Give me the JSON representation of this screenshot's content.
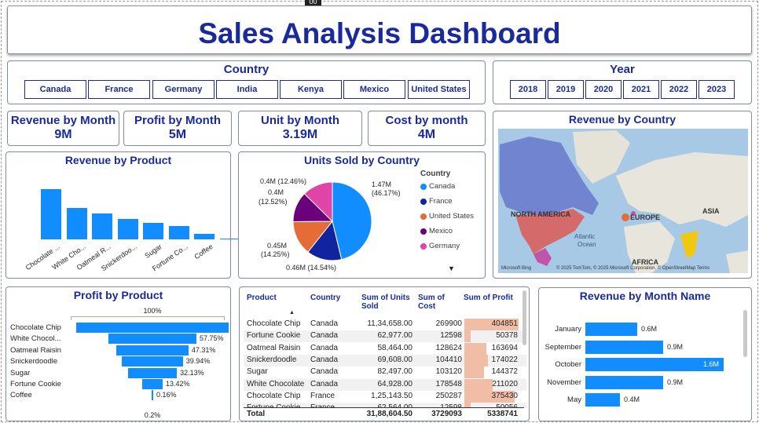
{
  "header": {
    "title": "Sales Analysis Dashboard",
    "tag": "00"
  },
  "country_slicer": {
    "title": "Country",
    "items": [
      "Canada",
      "France",
      "Germany",
      "India",
      "Kenya",
      "Mexico",
      "United States"
    ]
  },
  "year_slicer": {
    "title": "Year",
    "items": [
      "2018",
      "2019",
      "2020",
      "2021",
      "2022",
      "2023"
    ]
  },
  "kpis": [
    {
      "title": "Revenue by Month",
      "value": "9M"
    },
    {
      "title": "Profit by Month",
      "value": "5M"
    },
    {
      "title": "Unit by Month",
      "value": "3.19M"
    },
    {
      "title": "Cost by month",
      "value": "4M"
    }
  ],
  "revenue_map": {
    "title": "Revenue by Country",
    "labels": {
      "na": "NORTH AMERICA",
      "europe": "EUROPE",
      "asia": "ASIA",
      "africa": "AFRICA",
      "atlantic": "Atlantic",
      "ocean": "Ocean"
    },
    "attribution": "© 2025 TomTom, © 2025 Microsoft Corporation, © OpenStreetMap  Terms",
    "bing": "Microsoft Bing"
  },
  "chart_data": [
    {
      "type": "bar",
      "title": "Revenue by Product",
      "categories": [
        "Chocolate ...",
        "White Cho...",
        "Oatmeal R...",
        "Snickerdoo...",
        "Sugar",
        "Fortune Co...",
        "Coffee"
      ],
      "values": [
        100,
        63,
        52,
        40,
        33,
        27,
        11,
        1
      ]
    },
    {
      "type": "pie",
      "title": "Units Sold by Country",
      "legend_title": "Country",
      "legend": [
        "Canada",
        "France",
        "United States",
        "Mexico",
        "Germany"
      ],
      "slices": [
        {
          "name": "Canada",
          "value": 1.47,
          "label": "1.47M",
          "pct": "(46.17%)",
          "color": "#118dff"
        },
        {
          "name": "France",
          "value": 0.46,
          "label": "0.46M (14.54%)",
          "color": "#12239e"
        },
        {
          "name": "United States",
          "value": 0.45,
          "label": "0.45M",
          "pct": "(14.25%)",
          "color": "#e66c37"
        },
        {
          "name": "Mexico",
          "value": 0.4,
          "label": "0.4M",
          "pct": "(12.52%)",
          "color": "#6b007b"
        },
        {
          "name": "Germany",
          "value": 0.4,
          "label": "0.4M (12.46%)",
          "color": "#e044a7"
        }
      ]
    },
    {
      "type": "bar",
      "title": "Profit by Product",
      "top_label": "100%",
      "bottom_label": "0.2%",
      "categories": [
        "Chocolate Chip",
        "White Chocol...",
        "Oatmeal Raisin",
        "Snickerdoodle",
        "Sugar",
        "Fortune Cookie",
        "Coffee"
      ],
      "values": [
        100,
        57.75,
        47.31,
        39.94,
        32.13,
        13.42,
        0.16
      ],
      "labels": [
        "",
        "57.75%",
        "47.31%",
        "39.94%",
        "32.13%",
        "13.42%",
        "0.16%"
      ]
    },
    {
      "type": "bar",
      "title": "Revenue by Month Name",
      "categories": [
        "January",
        "September",
        "October",
        "November",
        "May"
      ],
      "values": [
        0.6,
        0.9,
        1.6,
        0.9,
        0.4
      ],
      "labels": [
        "0.6M",
        "0.9M",
        "1.6M",
        "0.9M",
        "0.4M"
      ]
    }
  ],
  "table": {
    "headers": [
      "Product",
      "Country",
      "Sum of Units Sold",
      "Sum of Cost",
      "Sum of Profit"
    ],
    "rows": [
      [
        "Chocolate Chip",
        "Canada",
        "11,34,658.00",
        "269900",
        "404851"
      ],
      [
        "Fortune Cookie",
        "Canada",
        "62,977.00",
        "12598",
        "50378"
      ],
      [
        "Oatmeal Raisin",
        "Canada",
        "58,464.00",
        "128624",
        "163694"
      ],
      [
        "Snickerdoodle",
        "Canada",
        "69,608.00",
        "104410",
        "174022"
      ],
      [
        "Sugar",
        "Canada",
        "82,497.00",
        "103120",
        "144372"
      ],
      [
        "White Chocolate",
        "Canada",
        "64,928.00",
        "178548",
        "211020"
      ],
      [
        "Chocolate Chip",
        "France",
        "1,25,143.50",
        "250287",
        "375430"
      ],
      [
        "Fortune Cookie",
        "France",
        "62,564.00",
        "12598",
        "50056"
      ]
    ],
    "profit_fraction": [
      1.0,
      0.12,
      0.4,
      0.43,
      0.36,
      0.52,
      0.93,
      0.12
    ],
    "total": [
      "Total",
      "",
      "31,88,604.50",
      "3729093",
      "5338741"
    ]
  }
}
